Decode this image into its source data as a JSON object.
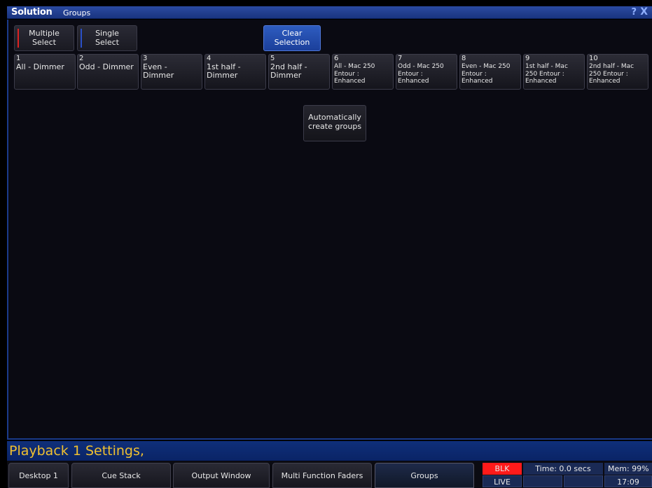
{
  "window": {
    "brand": "Solution",
    "title": "Groups",
    "help_icon": "?",
    "close_icon": "X"
  },
  "toolbar": {
    "multiple_select": "Multiple\nSelect",
    "single_select": "Single\nSelect",
    "clear_selection": "Clear\nSelection"
  },
  "groups": [
    {
      "num": "1",
      "label": "All - Dimmer"
    },
    {
      "num": "2",
      "label": "Odd - Dimmer"
    },
    {
      "num": "3",
      "label": "Even -\nDimmer"
    },
    {
      "num": "4",
      "label": "1st half -\nDimmer"
    },
    {
      "num": "5",
      "label": "2nd half -\nDimmer"
    },
    {
      "num": "6",
      "label": "All - Mac 250\nEntour :\nEnhanced"
    },
    {
      "num": "7",
      "label": "Odd - Mac 250\nEntour :\nEnhanced"
    },
    {
      "num": "8",
      "label": "Even - Mac 250\nEntour :\nEnhanced"
    },
    {
      "num": "9",
      "label": "1st half - Mac\n250 Entour :\nEnhanced"
    },
    {
      "num": "10",
      "label": "2nd half - Mac\n250 Entour :\nEnhanced"
    }
  ],
  "auto_create": "Automatically\ncreate groups",
  "status": "Playback 1 Settings,",
  "taskbar": {
    "tabs": [
      "Desktop 1",
      "Cue Stack",
      "Output Window",
      "Multi Function Faders",
      "Groups"
    ],
    "active": "Groups"
  },
  "indicators": {
    "blk": "BLK",
    "live": "LIVE",
    "time": "Time: 0.0 secs",
    "mem": "Mem: 99%",
    "clock": "17:09"
  },
  "colors": {
    "accent": "#1a3580",
    "blk": "#ff1a1a",
    "status_text": "#f0c030"
  }
}
